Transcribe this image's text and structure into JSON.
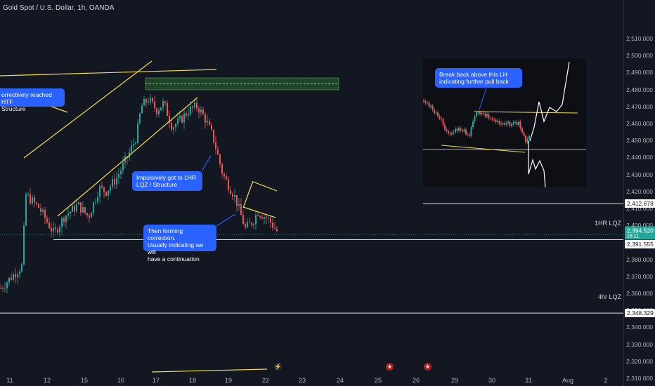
{
  "header": {
    "title": "Gold Spot / U.S. Dollar, 1h, OANDA"
  },
  "chart_data": {
    "type": "candlestick",
    "symbol": "Gold Spot / U.S. Dollar",
    "interval": "1h",
    "source": "OANDA",
    "yaxis": {
      "ticks": [
        "2,510.000",
        "2,500.000",
        "2,490.000",
        "2,480.000",
        "2,470.000",
        "2,460.000",
        "2,450.000",
        "2,440.000",
        "2,430.000",
        "2,420.000",
        "2,410.000",
        "2,400.000",
        "2,390.000",
        "2,380.000",
        "2,370.000",
        "2,360.000",
        "2,350.000",
        "2,340.000",
        "2,330.000",
        "2,320.000",
        "2,310.000"
      ],
      "ylim": [
        2305,
        2515
      ]
    },
    "xaxis": {
      "ticks": [
        "11",
        "12",
        "15",
        "16",
        "17",
        "18",
        "19",
        "22",
        "23",
        "24",
        "25",
        "26",
        "29",
        "30",
        "31",
        "Aug",
        "2"
      ]
    },
    "price_tags": [
      {
        "name": "level-2412",
        "label": "2,412.678",
        "style": "white"
      },
      {
        "name": "last-price",
        "label": "2,394.520",
        "sub": "16:11",
        "style": "green"
      },
      {
        "name": "level-2391",
        "label": "2,391.555",
        "style": "white"
      },
      {
        "name": "level-2348",
        "label": "2,348.329",
        "style": "white"
      }
    ],
    "levels": [
      {
        "name": "1hr-lqz",
        "label": "1HR LQZ",
        "price": 2391.555
      },
      {
        "name": "4hr-lqz",
        "label": "4hr LQZ",
        "price": 2348.329
      }
    ],
    "annotations": [
      {
        "name": "callout-htf",
        "text": "orrectively reached HTF\nStructure"
      },
      {
        "name": "callout-impulse",
        "text": "Impulsively got to 1HR\nLQZ / Structure"
      },
      {
        "name": "callout-correction",
        "text": "Then forming correction.\nUsually indicating we will\nhave a continuation"
      },
      {
        "name": "callout-inset",
        "text": "Break back above this LH\nindicating further pull back"
      }
    ],
    "colors": {
      "up": "#26a69a",
      "down": "#ef5350",
      "trendline": "#f5dc4e",
      "zone": "#2e7d32",
      "background": "#131722",
      "callout": "#2962ff"
    }
  }
}
